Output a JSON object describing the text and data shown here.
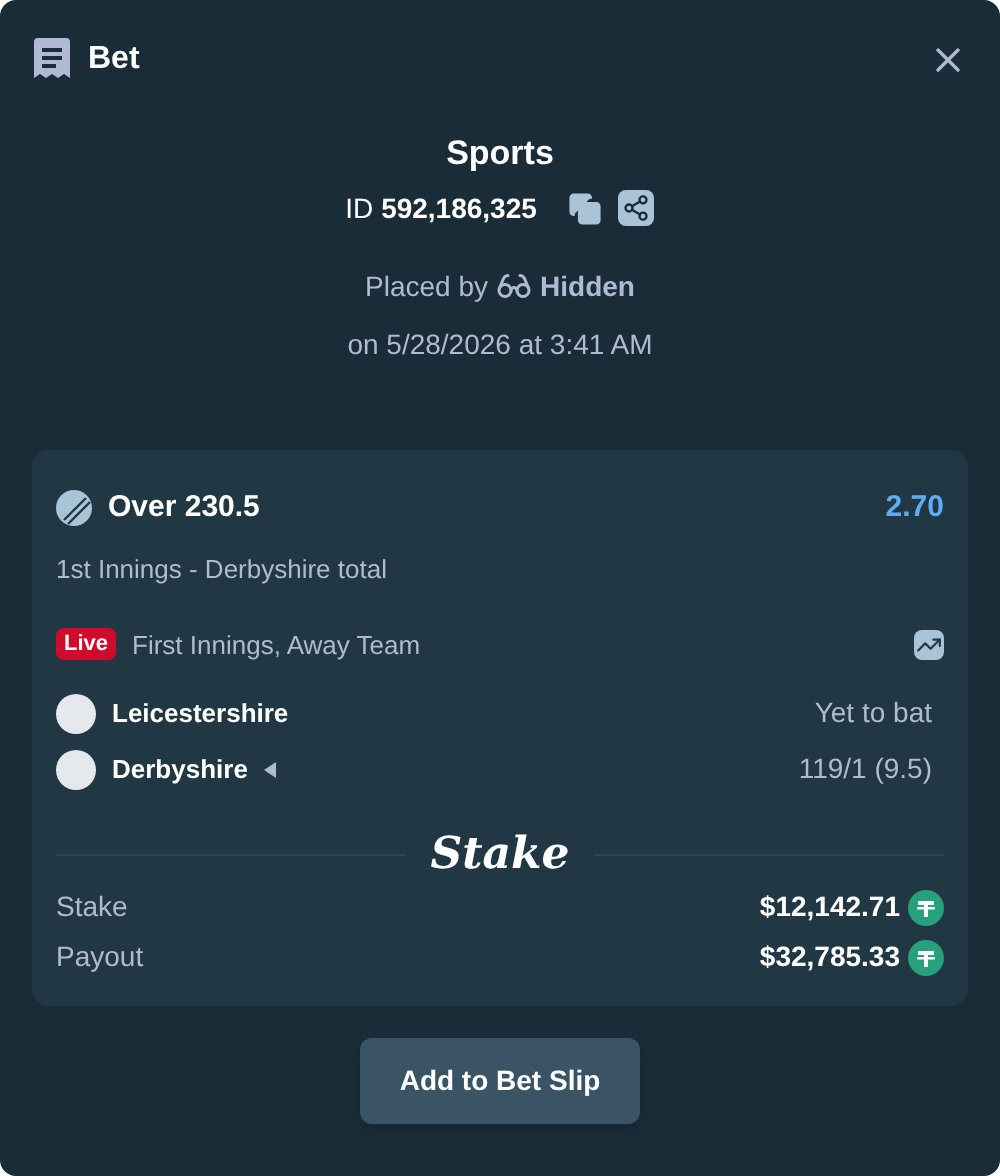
{
  "header": {
    "title": "Bet"
  },
  "summary": {
    "category": "Sports",
    "id_label": "ID",
    "id_value": "592,186,325",
    "placed_by_label": "Placed by",
    "placed_by_user": "Hidden",
    "placed_on": "on 5/28/2026 at 3:41 AM"
  },
  "bet": {
    "selection": "Over 230.5",
    "odds": "2.70",
    "market": "1st Innings - Derbyshire total",
    "live_badge": "Live",
    "status": "First Innings, Away Team",
    "teams": [
      {
        "name": "Leicestershire",
        "score": "Yet to bat",
        "batting": false
      },
      {
        "name": "Derbyshire",
        "score": "119/1 (9.5)",
        "batting": true
      }
    ],
    "logo": "Stake",
    "amounts": [
      {
        "label": "Stake",
        "value": "$12,142.71"
      },
      {
        "label": "Payout",
        "value": "$32,785.33"
      }
    ]
  },
  "action": "Add to Bet Slip"
}
